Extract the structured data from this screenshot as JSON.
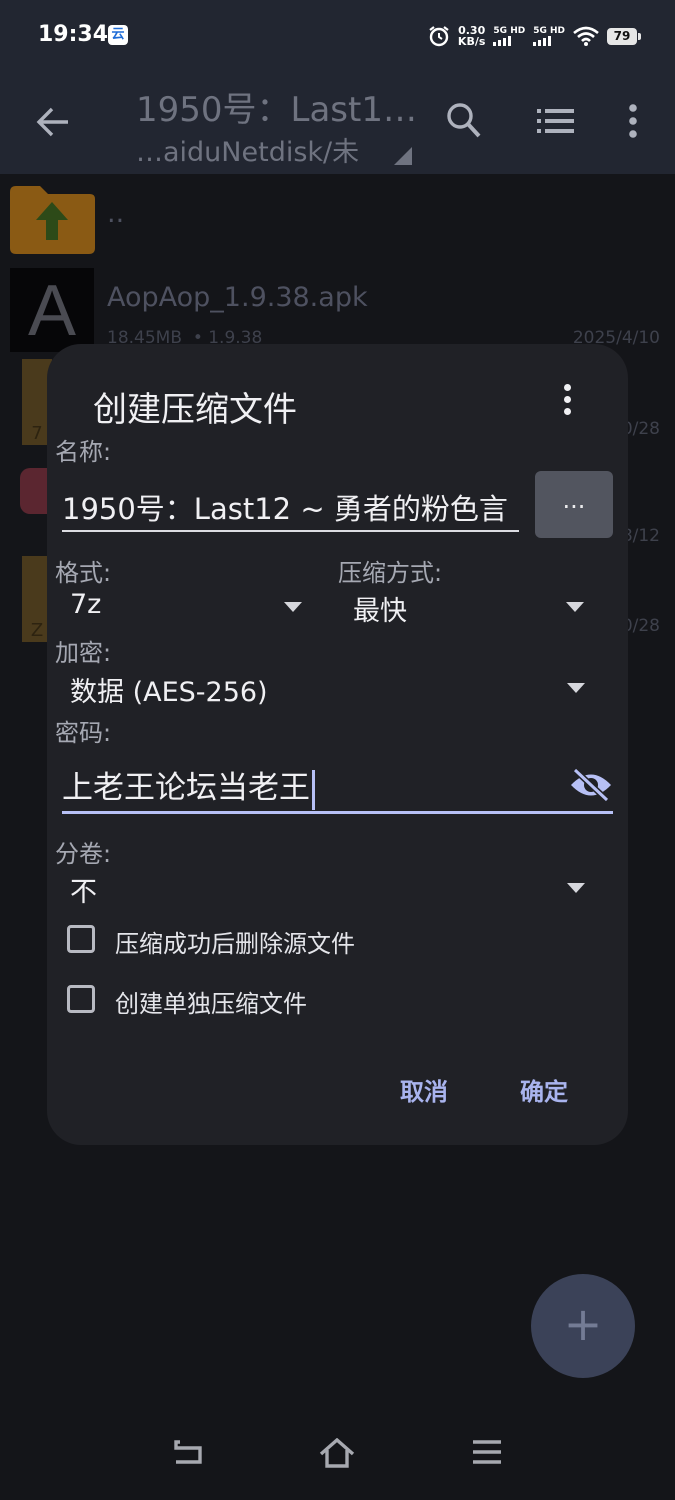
{
  "status": {
    "time": "19:34",
    "app_icon": "云",
    "net_speed_value": "0.30",
    "net_speed_unit": "KB/s",
    "signal1": "5G HD",
    "signal2": "5G HD",
    "battery": "79",
    "icons": [
      "alarm-icon",
      "wifi-icon",
      "battery-icon"
    ]
  },
  "appbar": {
    "title": "1950号：Last1…",
    "subtitle": "…aiduNetdisk/未",
    "icons": [
      "back-arrow-icon",
      "search-icon",
      "list-view-icon",
      "more-vert-icon"
    ]
  },
  "files": [
    {
      "name": "..",
      "icon": "folder-up-icon"
    },
    {
      "name": "AopAop_1.9.38.apk",
      "size": "18.45MB",
      "version": "• 1.9.38",
      "date": "2025/4/10",
      "icon": "apk-icon"
    },
    {
      "date": "0/28",
      "icon": "archive-7z-icon",
      "badge": "7"
    },
    {
      "date": "8/12",
      "icon": "anime-thumbnail-icon"
    },
    {
      "date": "0/28",
      "icon": "archive-zip-icon",
      "badge": "Z"
    }
  ],
  "dialog": {
    "title": "创建压缩文件",
    "name_label": "名称:",
    "name_value": "1950号：Last12 ~ 勇者的粉色言",
    "browse_label": "...",
    "format_label": "格式:",
    "format_value": "7z",
    "method_label": "压缩方式:",
    "method_value": "最快",
    "encrypt_label": "加密:",
    "encrypt_value": "数据 (AES-256)",
    "password_label": "密码:",
    "password_value": "上老王论坛当老王",
    "split_label": "分卷:",
    "split_value": "不",
    "checkbox1": "压缩成功后删除源文件",
    "checkbox2": "创建单独压缩文件",
    "cancel": "取消",
    "ok": "确定",
    "colors": {
      "accent": "#a9b4ee",
      "dialog_bg": "#202126",
      "underline_focus": "#b7c0f5"
    }
  },
  "fab": {
    "label": "+"
  },
  "navbar": {
    "icons": [
      "back-nav-icon",
      "home-nav-icon",
      "menu-nav-icon"
    ]
  }
}
